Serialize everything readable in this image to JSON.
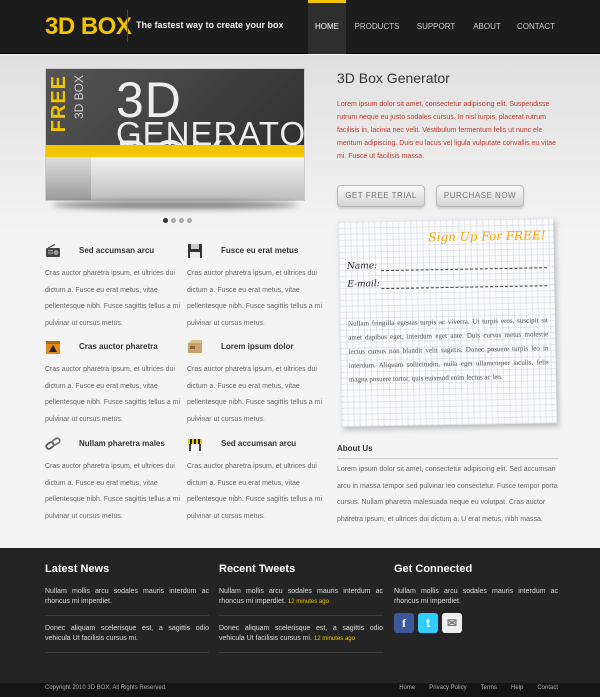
{
  "header": {
    "logo": "3D BOX",
    "tagline": "The fastest way to create your box",
    "nav": [
      "HOME",
      "PRODUCTS",
      "SUPPORT",
      "ABOUT",
      "CONTACT"
    ],
    "active_nav": "HOME"
  },
  "slider": {
    "line_free": "FREE",
    "line_side": "3D BOX",
    "title_1": "3D BOX",
    "title_2": "GENERATOR",
    "slides": 4,
    "current_slide": 1
  },
  "hero": {
    "title": "3D Box Generator",
    "text": "Lorem ipsum dolor sit amet, consectetur adipiscing elit. Suspendisse rutrum neque eu justo sodales cursus. In nisl turpis, placerat rutrum facilisis in, lacinia nec velit. Vestibulum fermentum felis ut nunc ele mentum adipiscing. Duis eu lacus vel ligula vulputate convallis eu vitae mi. Fusce ut facilisis massa.",
    "btn_trial": "GET FREE TRIAL",
    "btn_purchase": "PURCHASE NOW"
  },
  "features": [
    {
      "title": "Sed accumsan arcu",
      "icon": "radio-icon",
      "text": "Cras auctor pharetra ipsum, et ultrices dui dictum a. Fusce eu erat metus, vitae pellentesque nibh. Fusce sagittis tellus a mi pulvinar ut cursus metus."
    },
    {
      "title": "Fusce eu erat metus",
      "icon": "floppy-disk-icon",
      "text": "Cras auctor pharetra ipsum, et ultrices dui dictum a. Fusce eu erat metus, vitae pellentesque nibh. Fusce sagittis tellus a mi pulvinar ut cursus metus."
    },
    {
      "title": "Cras auctor pharetra",
      "icon": "hazard-box-icon",
      "text": "Cras auctor pharetra ipsum, et ultrices dui dictum a. Fusce eu erat metus, vitae pellentesque nibh. Fusce sagittis tellus a mi pulvinar ut cursus metus."
    },
    {
      "title": "Lorem ipsum dolor",
      "icon": "package-icon",
      "text": "Cras auctor pharetra ipsum, et ultrices dui dictum a. Fusce eu erat metus, vitae pellentesque nibh. Fusce sagittis tellus a mi pulvinar ut cursus metus."
    },
    {
      "title": "Nullam pharetra males",
      "icon": "chain-link-icon",
      "text": "Cras auctor pharetra ipsum, et ultrices dui dictum a. Fusce eu erat metus, vitae pellentesque nibh. Fusce sagittis tellus a mi pulvinar ut cursus metus."
    },
    {
      "title": "Sed accumsan arcu",
      "icon": "barrier-icon",
      "text": "Cras auctor pharetra ipsum, et ultrices dui dictum a. Fusce eu erat metus, vitae pellentesque nibh. Fusce sagittis tellus a mi pulvinar ut cursus metus."
    }
  ],
  "signup": {
    "title": "Sign Up For FREE!",
    "name_label": "Name:",
    "email_label": "E-mail:",
    "text": "Nullam fringilla egestas turpis ac viverra. Ut turpis eros, suscipit sit amet dapibus eget, interdum eget ante. Duis cursus metus molestie lectus cursus non blandit velit sagittis. Donec posuere turpis leo in interdum. Aliquam sollicitudin, nulla eget ullamcorper iaculis, felis magna posuere tortor, quis euismod enim lectus ac leo."
  },
  "about": {
    "title": "About Us",
    "text": "Lorem ipsum dolor sit amet, consectetur adipiscing elit. Sed accumsan arcu in massa tempor sed pulvinar leo consectetur. Fusce tempor porta cursus. Nullam pharetra malesuada neque eu volutpat. Cras auctor pharetra ipsum, et ultrices dui dictum a. U erat metus, nibh massa."
  },
  "footer": {
    "news_title": "Latest News",
    "news": [
      "Nullam mollis arcu sodales mauris interdum ac rhoncus mi imperdiet.",
      "Donec aliquam scelerisque est, a sagittis odio vehicula Ut facilisis cursus mi."
    ],
    "tweets_title": "Recent Tweets",
    "tweets": [
      {
        "text": "Nullam mollis arcu sodales mauris interdum ac rhoncus mi imperdiet.",
        "time": "12 minutes ago"
      },
      {
        "text": "Donec aliquam scelerisque est, a sagittis odio vehicula Ut facilisis cursus mi.",
        "time": "12 minutes ago"
      }
    ],
    "connect_title": "Get Connected",
    "connect_text": "Nullam mollis arcu sodales mauris interdum ac rhoncus mi imperdiet.",
    "social": [
      {
        "name": "facebook-icon",
        "glyph": "f",
        "color": "#3b5998"
      },
      {
        "name": "twitter-icon",
        "glyph": "t",
        "color": "#33ccff"
      },
      {
        "name": "mail-icon",
        "glyph": "✉",
        "color": "#eeeeee"
      }
    ],
    "copyright": "Copyright 2010 3D BOX, All Rights Reserved.",
    "links": [
      "Home",
      "Privacy Policy",
      "Terms",
      "Help",
      "Contact"
    ]
  },
  "colors": {
    "accent": "#f2c500",
    "header_bg": "#1c1c1c",
    "footer_bg": "#242424",
    "hero_text": "#c0392b"
  }
}
